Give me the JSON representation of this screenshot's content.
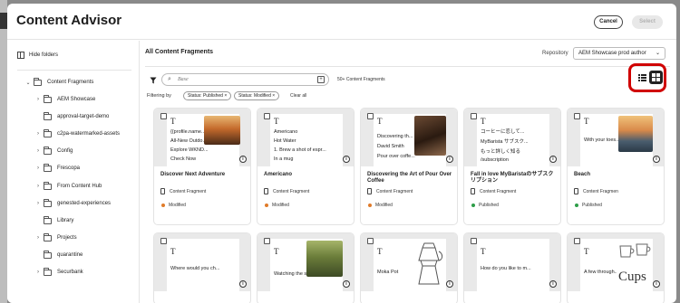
{
  "dialog": {
    "title": "Content Advisor",
    "cancel_label": "Cancel",
    "select_label": "Select"
  },
  "sidebar": {
    "hide_folders_label": "Hide folders",
    "items": [
      {
        "label": "Content Fragments",
        "chevron": "⌄",
        "expanded": true
      },
      {
        "label": "AEM Showcase",
        "chevron": "›"
      },
      {
        "label": "approval-target-demo",
        "chevron": ""
      },
      {
        "label": "c2pa-watermarked-assets",
        "chevron": "›"
      },
      {
        "label": "Config",
        "chevron": "›"
      },
      {
        "label": "Frescopa",
        "chevron": "›"
      },
      {
        "label": "From Content Hub",
        "chevron": "›"
      },
      {
        "label": "genested-experiences",
        "chevron": "›"
      },
      {
        "label": "Library",
        "chevron": ""
      },
      {
        "label": "Projects",
        "chevron": "›"
      },
      {
        "label": "quarantine",
        "chevron": ""
      },
      {
        "label": "Securbank",
        "chevron": "›"
      }
    ]
  },
  "main": {
    "title": "All Content Fragments",
    "repository_label": "Repository",
    "repository_value": "AEM Showcase prod author",
    "search_placeholder": "Base",
    "result_count": "50+ Content Fragments",
    "filtering_by": "Filtering by",
    "chips": [
      "Status: Published",
      "Status: Modified"
    ],
    "clear_all": "Clear all"
  },
  "cards": [
    {
      "lines": [
        "{{profile.name...",
        "All-New Outdo...",
        "Explore WKND...",
        "Check Now"
      ],
      "title": "Discover Next Adventure",
      "type": "Content Fragment",
      "status": "Modified",
      "image": "sunset-hike"
    },
    {
      "lines": [
        "Americano",
        "Hot Water",
        "1. Brew a shot of espr...",
        "In a mug"
      ],
      "title": "Americano",
      "type": "Content Fragment",
      "status": "Modified",
      "image": ""
    },
    {
      "lines": [
        "Discovering th...",
        "David Smith",
        "Pour over coffe..."
      ],
      "title": "Discovering the Art of Pour Over Coffee",
      "type": "Content Fragment",
      "status": "Modified",
      "image": "coffee"
    },
    {
      "lines": [
        "コーヒーに恋して...",
        "MyBarista サブスク...",
        "もっと詳しく知る",
        "/subscription"
      ],
      "title": "Fall in love MyBaristaのサブスクリプション",
      "type": "Content Fragment",
      "status": "Published",
      "image": ""
    },
    {
      "lines": [
        "With your toes..."
      ],
      "title": "Beach",
      "type": "Content Fragmen",
      "status": "Published",
      "image": "beach"
    },
    {
      "lines": [
        "Where would you ch..."
      ],
      "title": "",
      "type": "",
      "status": "",
      "image": ""
    },
    {
      "lines": [
        "Watching the s..."
      ],
      "title": "",
      "type": "",
      "status": "",
      "image": "landscape"
    },
    {
      "lines": [
        "Moka Pot"
      ],
      "title": "",
      "type": "",
      "status": "",
      "image": "moka"
    },
    {
      "lines": [
        "How do you like to m..."
      ],
      "title": "",
      "type": "",
      "status": "",
      "image": ""
    },
    {
      "lines": [
        "A few through..."
      ],
      "title": "",
      "type": "",
      "status": "",
      "image": "cups"
    }
  ],
  "cups_text": "Cups",
  "colors": {
    "modified": "#e07b2a",
    "published": "#2d9d48",
    "highlight": "#d00000"
  }
}
